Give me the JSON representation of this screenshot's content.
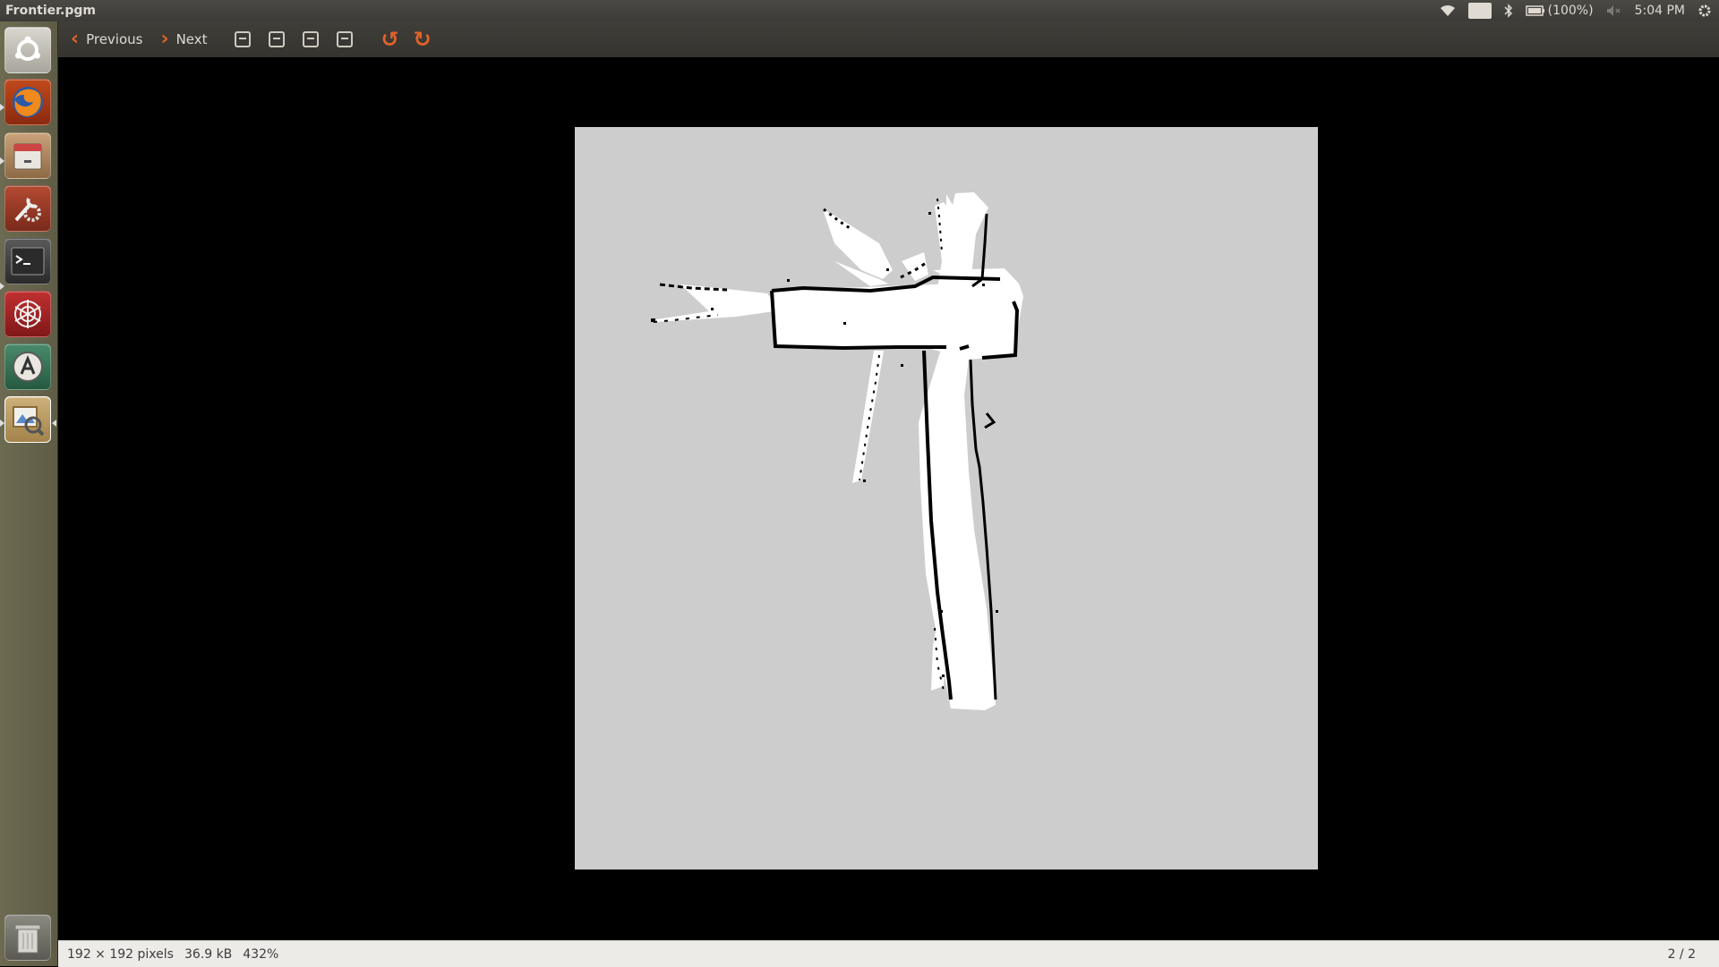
{
  "window": {
    "title": "Frontier.pgm"
  },
  "panel": {
    "keyboard": "En",
    "battery": "(100%)",
    "clock": "5:04 PM"
  },
  "toolbar": {
    "previous_label": "Previous",
    "next_label": "Next"
  },
  "launcher": {
    "items": [
      "ubuntu-dash",
      "firefox",
      "files",
      "system-settings",
      "terminal",
      "app-web",
      "software-updater",
      "image-viewer"
    ]
  },
  "status": {
    "dimensions": "192 × 192 pixels",
    "size": "36.9 kB",
    "zoom": "432%",
    "page": "2 / 2"
  },
  "colors": {
    "accent": "#e0632b",
    "map_unknown": "#cdcdcd",
    "map_free": "#ffffff",
    "map_occupied": "#000000"
  }
}
